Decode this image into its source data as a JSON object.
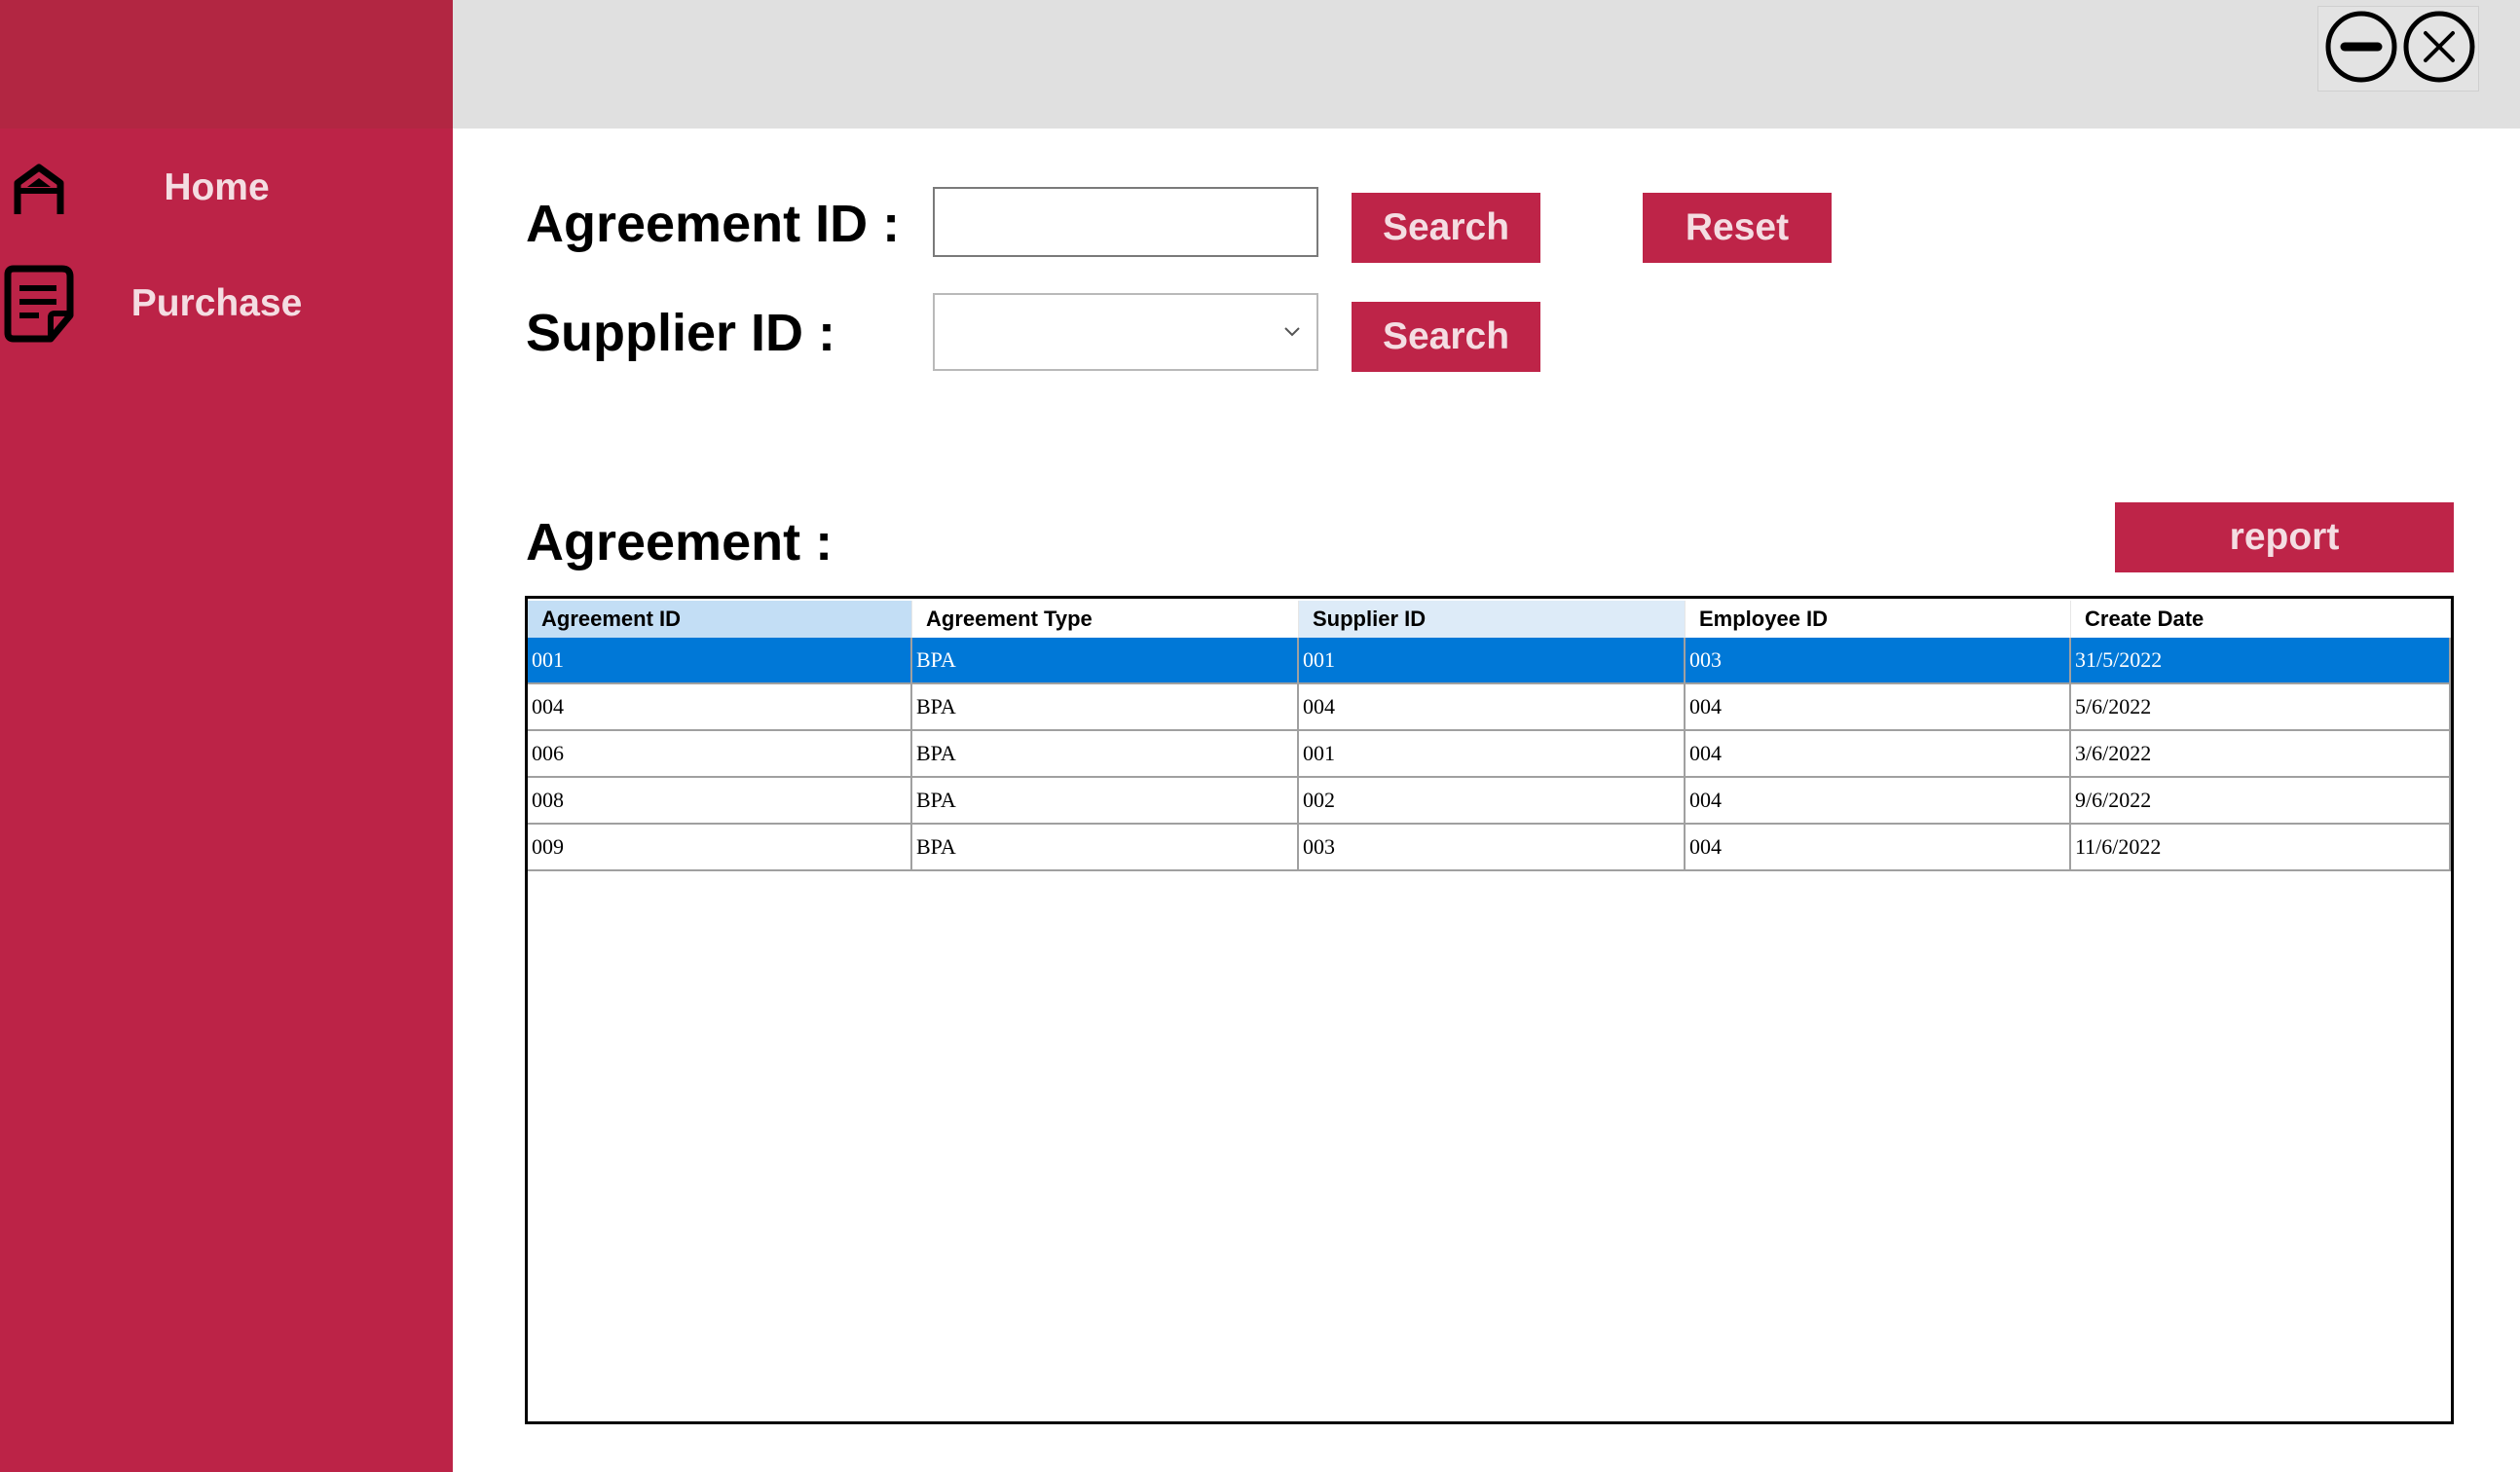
{
  "sidebar": {
    "items": [
      {
        "label": "Home",
        "icon": "home-icon"
      },
      {
        "label": "Purchase",
        "icon": "document-icon"
      }
    ]
  },
  "window_controls": {
    "minimize_icon": "minimize-icon",
    "close_icon": "close-icon"
  },
  "form": {
    "agreement_id_label": "Agreement ID :",
    "agreement_id_value": "",
    "supplier_id_label": "Supplier ID :",
    "supplier_id_value": "",
    "search_label": "Search",
    "reset_label": "Reset"
  },
  "agreement": {
    "title": "Agreement :",
    "report_label": "report",
    "columns": [
      "Agreement ID",
      "Agreement Type",
      "Supplier ID",
      "Employee ID",
      "Create Date"
    ],
    "rows": [
      [
        "001",
        "BPA",
        "001",
        "003",
        "31/5/2022"
      ],
      [
        "004",
        "BPA",
        "004",
        "004",
        "5/6/2022"
      ],
      [
        "006",
        "BPA",
        "001",
        "004",
        "3/6/2022"
      ],
      [
        "008",
        "BPA",
        "002",
        "004",
        "9/6/2022"
      ],
      [
        "009",
        "BPA",
        "003",
        "004",
        "11/6/2022"
      ]
    ],
    "selected_row": 0
  },
  "colors": {
    "sidebar": "#BC2347",
    "accent_button": "#BE2448",
    "selection": "#0078D7",
    "topbar": "#E0E0E0"
  }
}
